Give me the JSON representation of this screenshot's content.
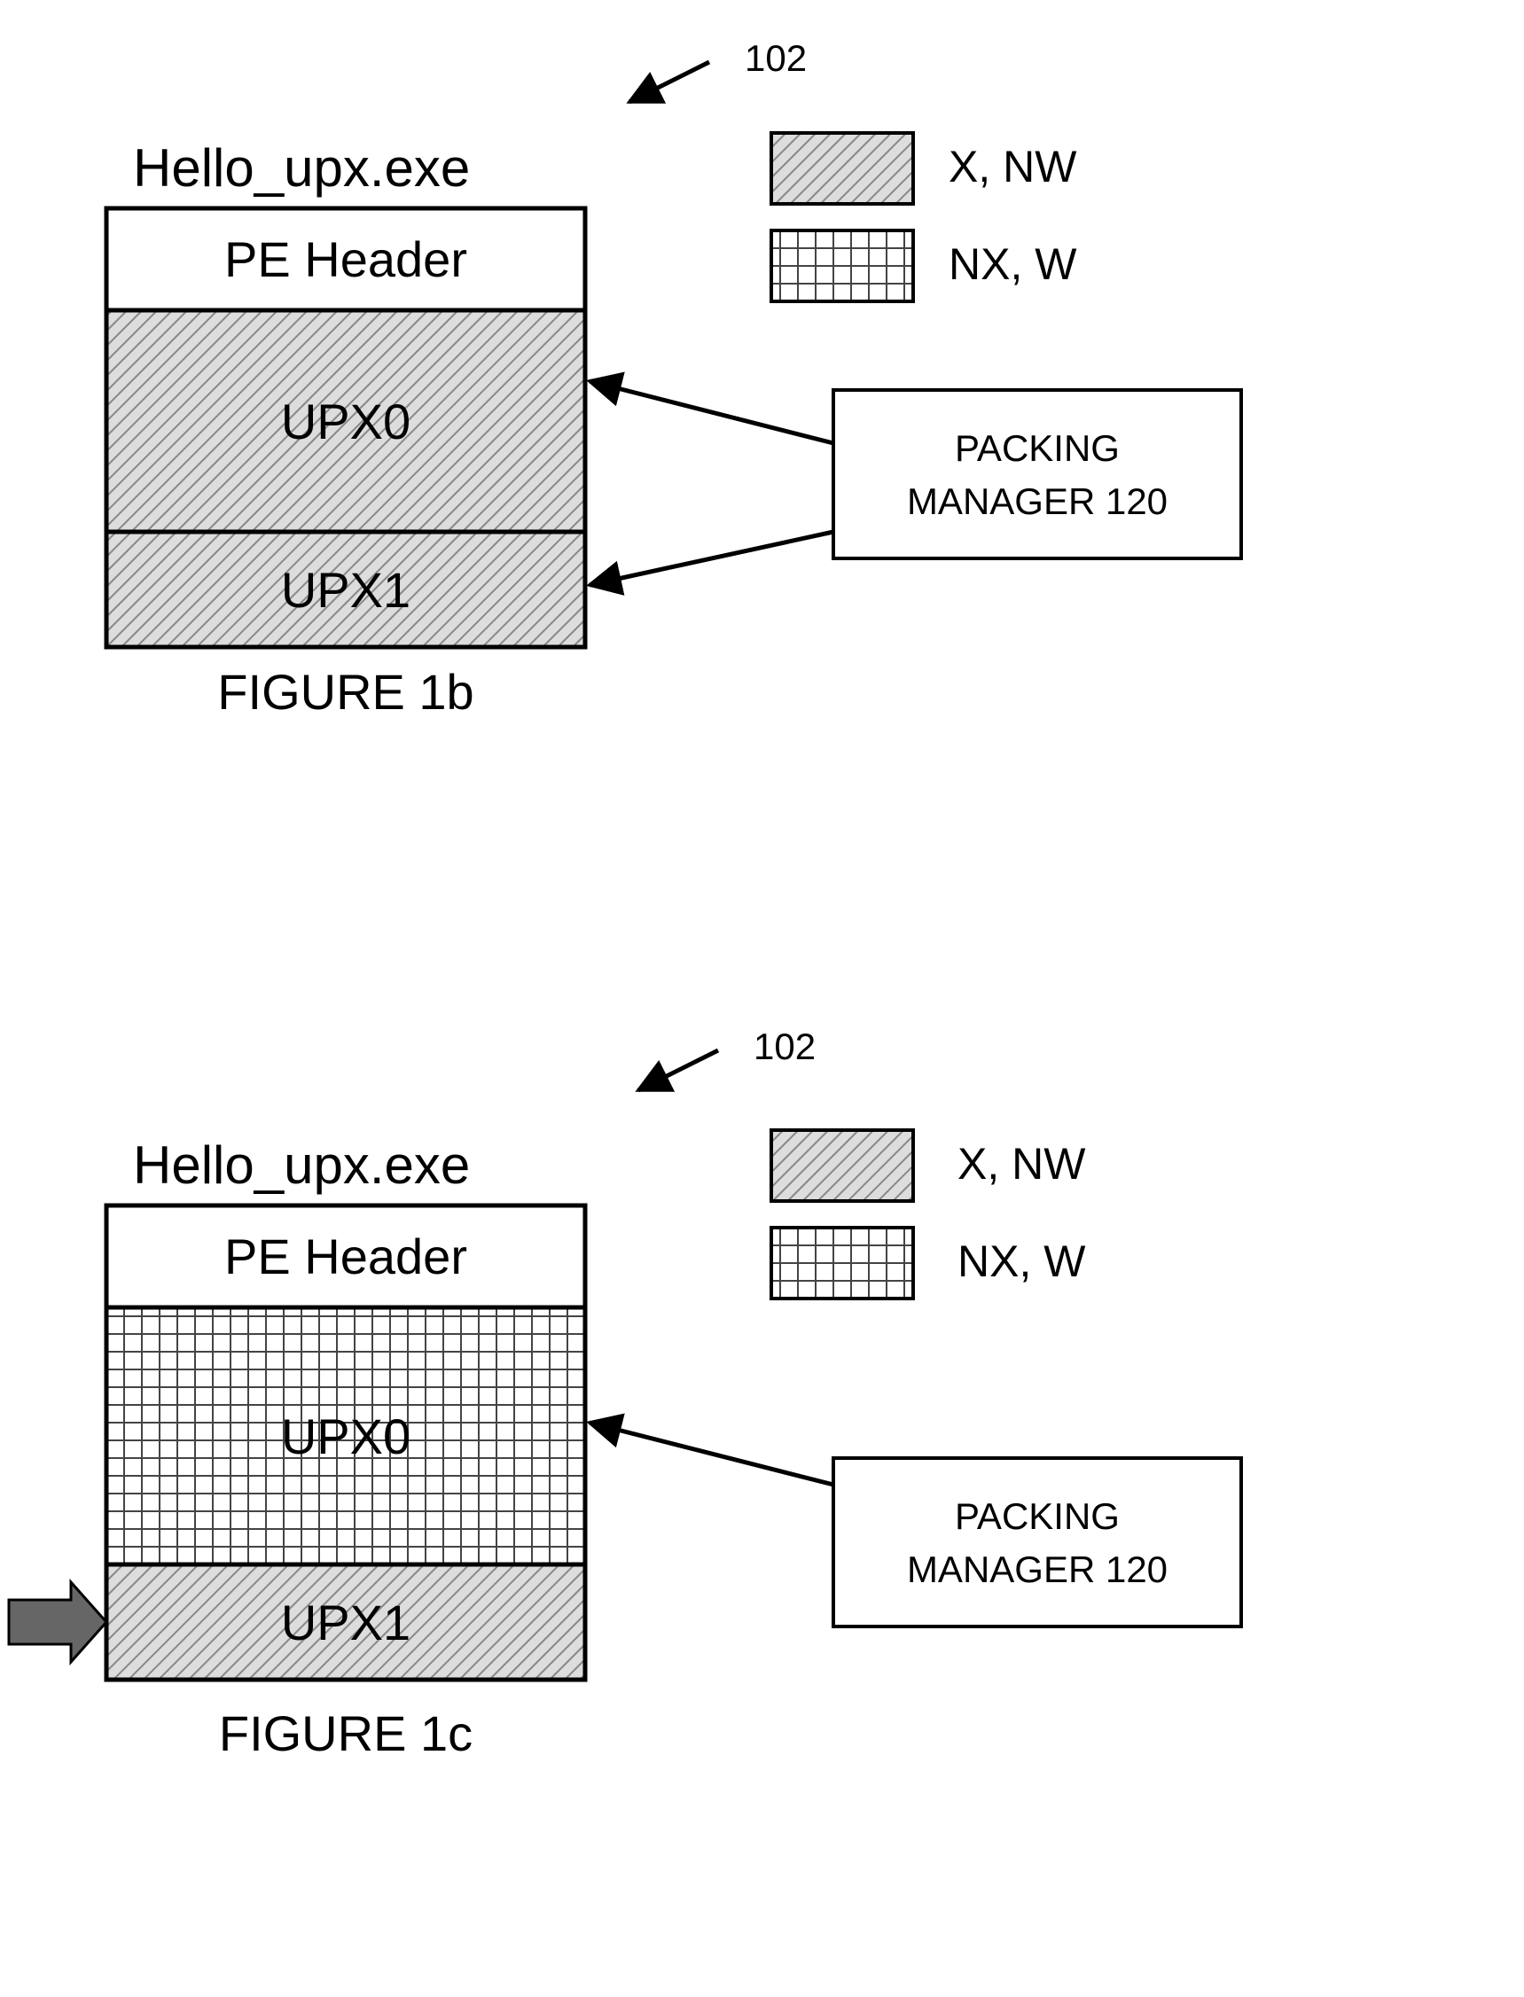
{
  "ref_num": "102",
  "legend": {
    "xnw": "X, NW",
    "nxw": "NX, W"
  },
  "manager_line1": "PACKING",
  "manager_line2": "MANAGER 120",
  "fig_b": {
    "title": "Hello_upx.exe",
    "header": "PE Header",
    "sec0": "UPX0",
    "sec1": "UPX1",
    "caption": "FIGURE 1b"
  },
  "fig_c": {
    "title": "Hello_upx.exe",
    "header": "PE Header",
    "sec0": "UPX0",
    "sec1": "UPX1",
    "caption": "FIGURE 1c"
  }
}
